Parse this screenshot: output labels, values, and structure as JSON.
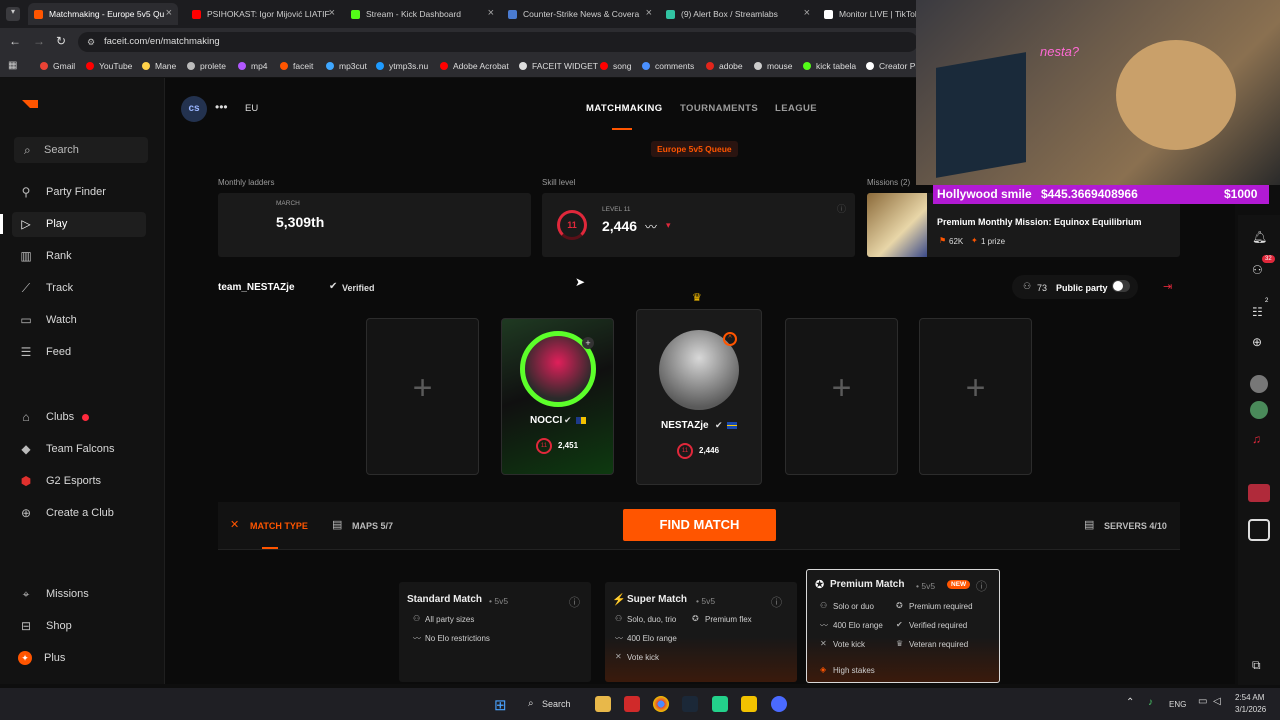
{
  "browser": {
    "tabs": [
      {
        "label": "Matchmaking - Europe 5v5 Qu",
        "color": "#ff5500"
      },
      {
        "label": "PSIHOKAST: Igor Mijović LIATIF",
        "color": "#ff0000"
      },
      {
        "label": "Stream - Kick Dashboard",
        "color": "#53fc18"
      },
      {
        "label": "Counter-Strike News & Covera",
        "color": "#4a7bd0"
      },
      {
        "label": "(9) Alert Box / Streamlabs",
        "color": "#31c3a2"
      },
      {
        "label": "Monitor LIVE | TikTok LI",
        "color": "#ffffff"
      }
    ],
    "url": "faceit.com/en/matchmaking",
    "bookmarks": [
      "Gmail",
      "YouTube",
      "Mane",
      "prolete",
      "mp4",
      "faceit",
      "mp3cut",
      "ytmp3s.nu",
      "Adobe Acrobat",
      "FACEIT WIDGET",
      "song",
      "comments",
      "adobe",
      "mouse",
      "kick tabela",
      "Creator Pr"
    ]
  },
  "sidebar": {
    "search_label": "Search",
    "items": [
      {
        "label": "Party Finder",
        "icon": "party-finder-icon"
      },
      {
        "label": "Play",
        "icon": "play-icon"
      },
      {
        "label": "Rank",
        "icon": "rank-icon"
      },
      {
        "label": "Track",
        "icon": "track-icon"
      },
      {
        "label": "Watch",
        "icon": "watch-icon"
      },
      {
        "label": "Feed",
        "icon": "feed-icon"
      }
    ],
    "clubs": [
      {
        "label": "Clubs",
        "icon": "clubs-icon"
      },
      {
        "label": "Team Falcons",
        "icon": "falcons-icon"
      },
      {
        "label": "G2 Esports",
        "icon": "g2-icon"
      },
      {
        "label": "Create a Club",
        "icon": "create-club-icon"
      }
    ],
    "bottom": [
      {
        "label": "Missions",
        "icon": "missions-icon"
      },
      {
        "label": "Shop",
        "icon": "shop-icon"
      },
      {
        "label": "Plus",
        "icon": "plus-icon"
      }
    ]
  },
  "header": {
    "game_badge": "cs",
    "region": "EU",
    "tabs": [
      "MATCHMAKING",
      "TOURNAMENTS",
      "LEAGUE"
    ],
    "queue_label": "Europe 5v5 Queue"
  },
  "stats": {
    "monthly_label": "Monthly ladders",
    "monthly_month": "MARCH",
    "monthly_rank": "5,309th",
    "skill_label": "Skill level",
    "skill_level_text": "LEVEL 11",
    "skill_level_num": "11",
    "skill_elo": "2,446",
    "missions_label": "Missions (2)",
    "mission_title": "Premium Monthly Mission: Equinox Equilibrium",
    "mission_points": "62K",
    "mission_prize": "1 prize"
  },
  "party": {
    "team_name": "team_NESTAZje",
    "verified_label": "Verified",
    "count": "73",
    "public_label": "Public party",
    "players": [
      {
        "name": "NOCCI",
        "elo": "2,451",
        "level": "11"
      },
      {
        "name": "NESTAZje",
        "elo": "2,446",
        "level": "11"
      }
    ]
  },
  "match": {
    "type_label": "MATCH TYPE",
    "maps_label": "MAPS 5/7",
    "find_label": "FIND MATCH",
    "servers_label": "SERVERS 4/10",
    "modes": [
      {
        "title": "Standard Match",
        "sub": "• 5v5",
        "features": [
          "All party sizes",
          "No Elo restrictions"
        ]
      },
      {
        "title": "Super Match",
        "sub": "• 5v5",
        "features": [
          "Solo, duo, trio",
          "Premium flex",
          "400 Elo range",
          "Vote kick"
        ]
      },
      {
        "title": "Premium Match",
        "sub": "• 5v5",
        "badge": "NEW",
        "features": [
          "Solo or duo",
          "Premium required",
          "400 Elo range",
          "Verified required",
          "Vote kick",
          "Veteran required",
          "High stakes"
        ]
      }
    ]
  },
  "overlay": {
    "donor": "Hollywood smile",
    "amount": "$445.3669408966",
    "goal": "$1000",
    "sign_text": "nesta?"
  },
  "rightbar": {
    "notif_count": "32",
    "friends_count": "2"
  },
  "taskbar": {
    "search_label": "Search",
    "lang": "ENG",
    "time": "2:54 AM",
    "date": "3/1/2026"
  },
  "colors": {
    "accent": "#ff5500",
    "bg": "#0b0b0b",
    "card": "#1a1a1a"
  }
}
